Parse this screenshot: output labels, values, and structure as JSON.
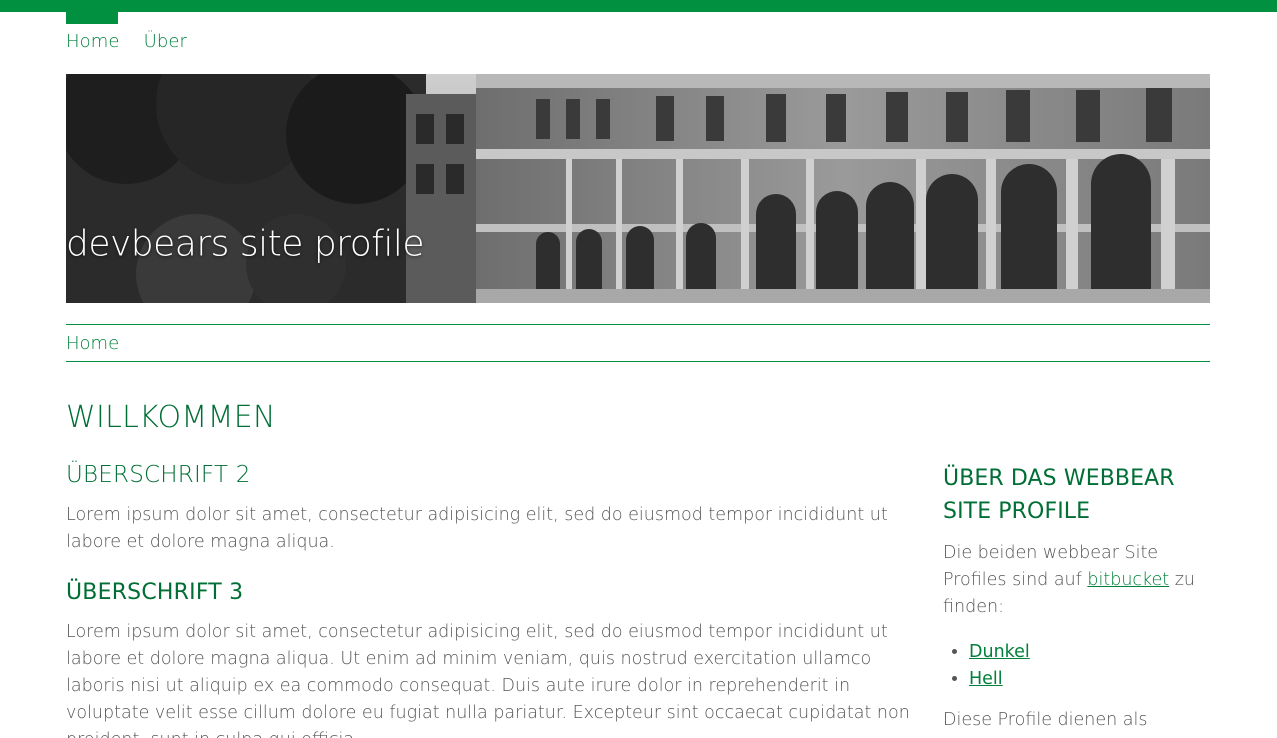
{
  "nav": {
    "items": [
      {
        "label": "Home"
      },
      {
        "label": "Über"
      }
    ]
  },
  "hero": {
    "title": "devbears site profile",
    "image_desc_icon": "building-facade-photo"
  },
  "breadcrumb": {
    "items": [
      {
        "label": "Home"
      }
    ]
  },
  "page": {
    "title": "WILLKOMMEN"
  },
  "main": {
    "h2": "ÜBERSCHRIFT 2",
    "p1": "Lorem ipsum dolor sit amet, consectetur adipisicing elit, sed do eiusmod tempor incididunt ut labore et dolore magna aliqua.",
    "h3": "ÜBERSCHRIFT 3",
    "p2": "Lorem ipsum dolor sit amet, consectetur adipisicing elit, sed do eiusmod tempor incididunt ut labore et dolore magna aliqua. Ut enim ad minim veniam, quis nostrud exercitation ullamco laboris nisi ut aliquip ex ea commodo consequat. Duis aute irure dolor in reprehenderit in voluptate velit esse cillum dolore eu fugiat nulla pariatur. Excepteur sint occaecat cupidatat non proident, sunt in culpa qui officia"
  },
  "aside": {
    "title": "ÜBER DAS WEBBEAR SITE PROFILE",
    "intro_before": "Die beiden webbear Site Profiles sind auf ",
    "intro_link": "bitbucket",
    "intro_after": " zu finden:",
    "links": [
      {
        "label": "Dunkel"
      },
      {
        "label": "Hell"
      }
    ],
    "outro": "Diese Profile dienen als"
  },
  "colors": {
    "brand_green": "#00903f",
    "heading_green": "#006e35",
    "text_gray": "#555555"
  }
}
